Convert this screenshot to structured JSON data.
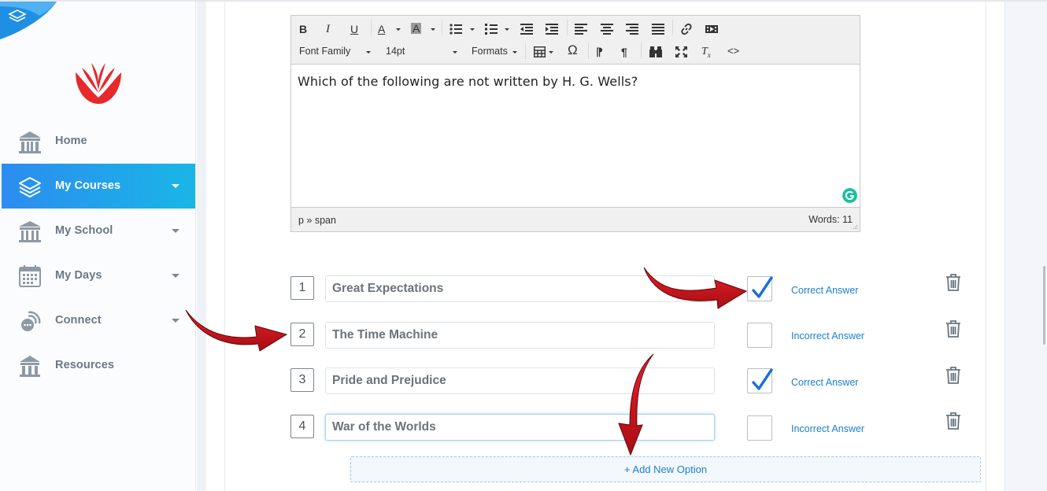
{
  "sidebar": {
    "items": [
      {
        "label": "Home",
        "icon": "home-icon",
        "caret": false,
        "active": false
      },
      {
        "label": "My Courses",
        "icon": "courses-icon",
        "caret": true,
        "active": true
      },
      {
        "label": "My School",
        "icon": "school-icon",
        "caret": true,
        "active": false
      },
      {
        "label": "My Days",
        "icon": "calendar-icon",
        "caret": true,
        "active": false
      },
      {
        "label": "Connect",
        "icon": "connect-icon",
        "caret": true,
        "active": false
      },
      {
        "label": "Resources",
        "icon": "resources-icon",
        "caret": false,
        "active": false
      }
    ]
  },
  "editor": {
    "toolbar": {
      "font_family": "Font Family",
      "font_size": "14pt",
      "formats": "Formats"
    },
    "content": "Which of the following are not written by H. G. Wells?",
    "status_path": "p » span",
    "word_count": "Words: 11"
  },
  "options": [
    {
      "number": "1",
      "text": "Great Expectations",
      "checked": true,
      "status": "Correct Answer"
    },
    {
      "number": "2",
      "text": "The Time Machine",
      "checked": false,
      "status": "Incorrect Answer"
    },
    {
      "number": "3",
      "text": "Pride and Prejudice",
      "checked": true,
      "status": "Correct Answer"
    },
    {
      "number": "4",
      "text": "War of the Worlds",
      "checked": false,
      "status": "Incorrect Answer"
    }
  ],
  "add_option_label": "+ Add New Option",
  "colors": {
    "accent": "#1a7fd4",
    "active_nav_start": "#2c8cf0",
    "active_nav_end": "#19b6e6",
    "logo_red": "#e8282a",
    "annotation_arrow": "#d0141b",
    "check_blue": "#1a6fd8"
  }
}
